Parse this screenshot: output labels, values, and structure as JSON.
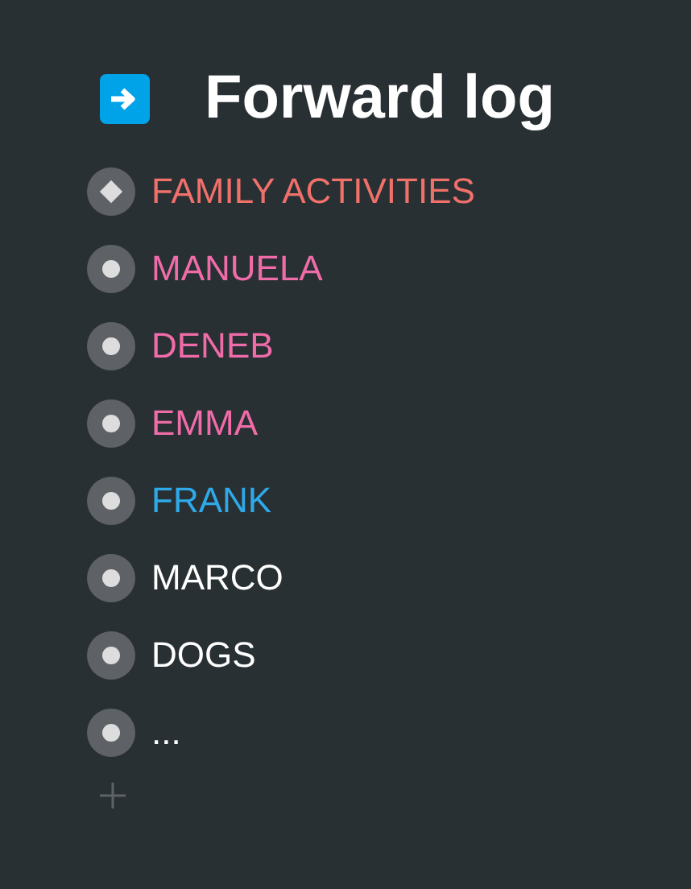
{
  "title": "Forward log",
  "items": [
    {
      "label": "FAMILY ACTIVITIES",
      "kind": "diamond",
      "color": "#f0706a"
    },
    {
      "label": "MANUELA",
      "kind": "dot",
      "color": "#f06ca8"
    },
    {
      "label": "DENEB",
      "kind": "dot",
      "color": "#f06ca8"
    },
    {
      "label": "EMMA",
      "kind": "dot",
      "color": "#f06ca8"
    },
    {
      "label": "FRANK",
      "kind": "dot",
      "color": "#2eaaea"
    },
    {
      "label": "MARCO",
      "kind": "dot",
      "color": "#ffffff"
    },
    {
      "label": "DOGS",
      "kind": "dot",
      "color": "#ffffff"
    },
    {
      "label": "...",
      "kind": "dot",
      "color": "#ffffff"
    }
  ]
}
